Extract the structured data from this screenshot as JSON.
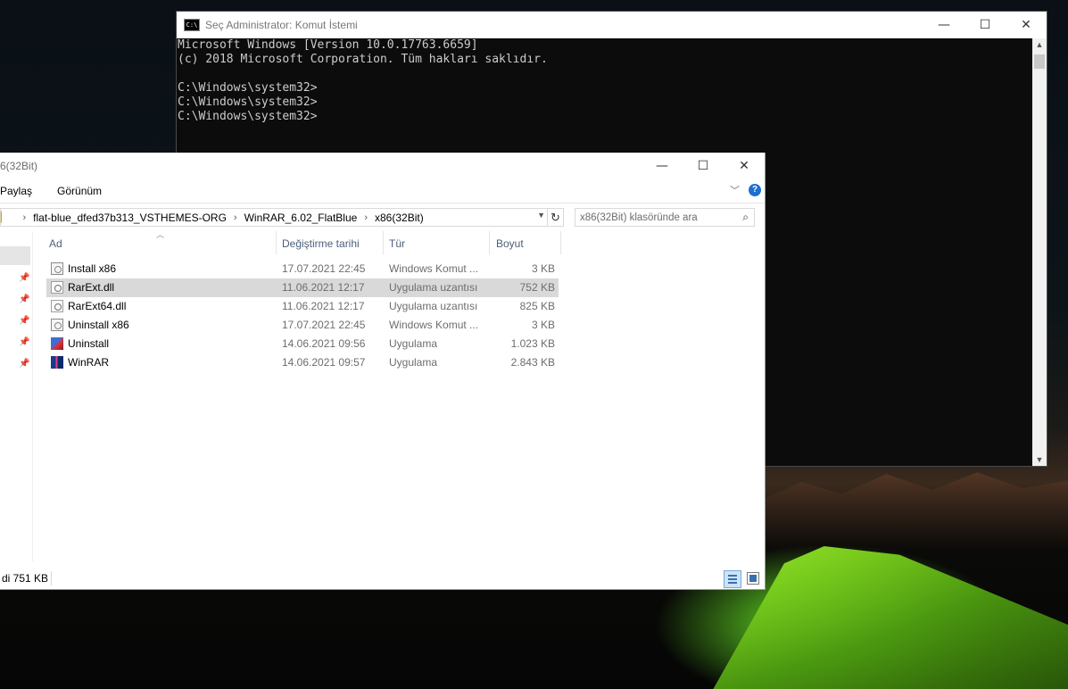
{
  "cmd": {
    "title": "Seç Administrator: Komut İstemi",
    "icon_label": "C:\\",
    "lines": [
      "Microsoft Windows [Version 10.0.17763.6659]",
      "(c) 2018 Microsoft Corporation. Tüm hakları saklıdır.",
      "",
      "C:\\Windows\\system32>",
      "C:\\Windows\\system32>",
      "C:\\Windows\\system32>"
    ],
    "minimize": "—",
    "maximize": "☐",
    "close": "✕"
  },
  "explorer": {
    "title": "6(32Bit)",
    "minimize": "—",
    "maximize": "☐",
    "close": "✕",
    "ribbon": {
      "share": "Paylaş",
      "view": "Görünüm",
      "help": "?"
    },
    "breadcrumb": [
      "flat-blue_dfed37b313_VSTHEMES-ORG",
      "WinRAR_6.02_FlatBlue",
      "x86(32Bit)"
    ],
    "search_placeholder": "x86(32Bit) klasöründe ara",
    "columns": {
      "name": "Ad",
      "date": "Değiştirme tarihi",
      "type": "Tür",
      "size": "Boyut"
    },
    "files": [
      {
        "name": "Install x86",
        "date": "17.07.2021 22:45",
        "type": "Windows Komut ...",
        "size": "3 KB",
        "icon": "cmd-script-icon"
      },
      {
        "name": "RarExt.dll",
        "date": "11.06.2021 12:17",
        "type": "Uygulama uzantısı",
        "size": "752 KB",
        "icon": "dll-icon"
      },
      {
        "name": "RarExt64.dll",
        "date": "11.06.2021 12:17",
        "type": "Uygulama uzantısı",
        "size": "825 KB",
        "icon": "dll-icon"
      },
      {
        "name": "Uninstall x86",
        "date": "17.07.2021 22:45",
        "type": "Windows Komut ...",
        "size": "3 KB",
        "icon": "cmd-script-icon"
      },
      {
        "name": "Uninstall",
        "date": "14.06.2021 09:56",
        "type": "Uygulama",
        "size": "1.023 KB",
        "icon": "uninstall-app-icon"
      },
      {
        "name": "WinRAR",
        "date": "14.06.2021 09:57",
        "type": "Uygulama",
        "size": "2.843 KB",
        "icon": "winrar-app-icon"
      }
    ],
    "status": "di  751 KB"
  }
}
